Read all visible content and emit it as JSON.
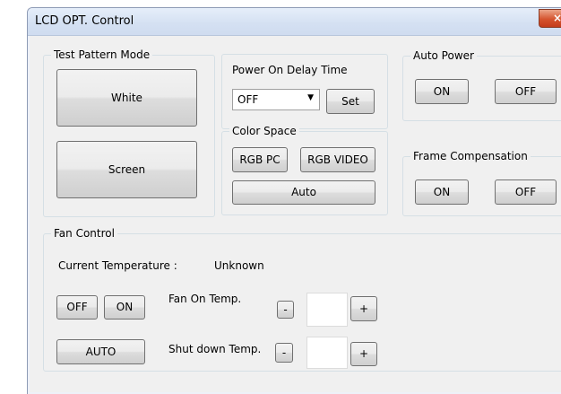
{
  "window": {
    "title": "LCD OPT. Control",
    "close_label": "×"
  },
  "test_pattern": {
    "legend": "Test Pattern Mode",
    "white_label": "White",
    "screen_label": "Screen"
  },
  "power_delay": {
    "legend": "Power On Delay Time",
    "value": "OFF",
    "set_label": "Set"
  },
  "color_space": {
    "legend": "Color Space",
    "rgb_pc_label": "RGB PC",
    "rgb_video_label": "RGB VIDEO",
    "auto_label": "Auto"
  },
  "auto_power": {
    "legend": "Auto Power",
    "on_label": "ON",
    "off_label": "OFF"
  },
  "frame_comp": {
    "legend": "Frame Compensation",
    "on_label": "ON",
    "off_label": "OFF"
  },
  "fan": {
    "legend": "Fan Control",
    "current_temp_label": "Current Temperature :",
    "current_temp_value": "Unknown",
    "off_label": "OFF",
    "on_label": "ON",
    "auto_label": "AUTO",
    "fan_on_temp_label": "Fan On Temp.",
    "shutdown_temp_label": "Shut down Temp.",
    "minus_label": "-",
    "plus_label": "+",
    "fan_on_temp_value": "",
    "shutdown_temp_value": ""
  }
}
